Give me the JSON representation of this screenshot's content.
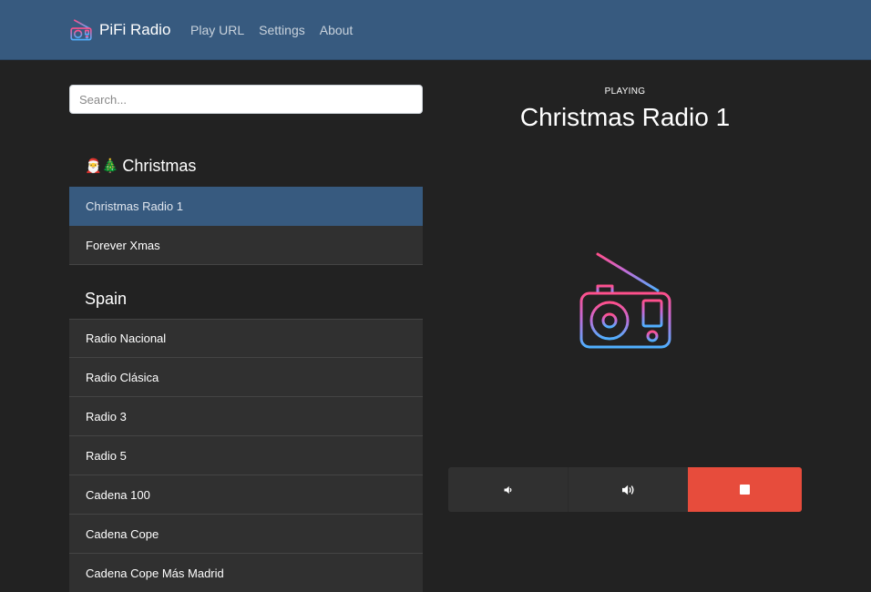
{
  "navbar": {
    "brand_name": "PiFi Radio",
    "brand_icon": "radio-icon",
    "links": [
      {
        "label": "Play URL"
      },
      {
        "label": "Settings"
      },
      {
        "label": "About"
      }
    ]
  },
  "search": {
    "placeholder": "Search...",
    "value": ""
  },
  "groups": [
    {
      "emoji": "🎅🎄",
      "title": "Christmas",
      "stations": [
        {
          "label": "Christmas Radio 1",
          "active": true
        },
        {
          "label": "Forever Xmas",
          "active": false
        }
      ]
    },
    {
      "emoji": "",
      "title": "Spain",
      "stations": [
        {
          "label": "Radio Nacional"
        },
        {
          "label": "Radio Clásica"
        },
        {
          "label": "Radio 3"
        },
        {
          "label": "Radio 5"
        },
        {
          "label": "Cadena 100"
        },
        {
          "label": "Cadena Cope"
        },
        {
          "label": "Cadena Cope Más Madrid"
        }
      ]
    }
  ],
  "player": {
    "status": "PLAYING",
    "station_title": "Christmas Radio 1",
    "artwork_icon": "radio-icon"
  },
  "controls": {
    "volume_down_icon": "volume-down-icon",
    "volume_up_icon": "volume-up-icon",
    "stop_icon": "stop-icon"
  },
  "colors": {
    "navbar": "#375a7f",
    "background": "#222222",
    "list_item": "#303030",
    "active_item": "#375a7f",
    "stop_button": "#e74c3c",
    "icon_gradient_start": "#ff4f8b",
    "icon_gradient_end": "#4fb0ff"
  }
}
